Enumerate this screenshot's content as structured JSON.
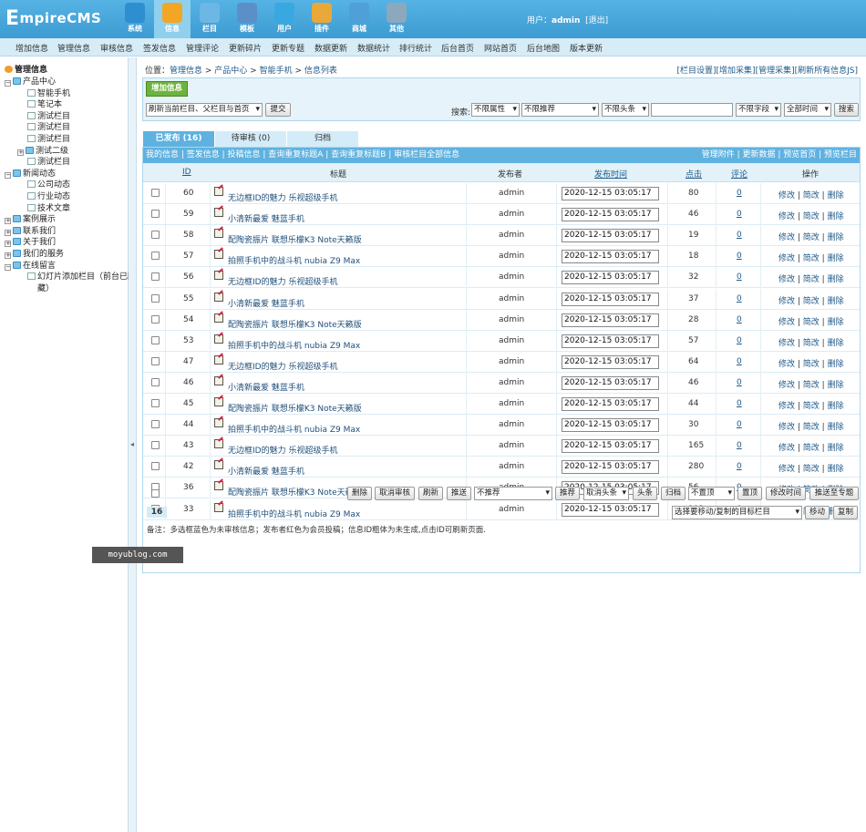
{
  "app": {
    "logo_big": "E",
    "logo_rest": "mpireCMS"
  },
  "nav": [
    {
      "label": "系统",
      "icon": "globe-icon",
      "color": "#2d8fd0"
    },
    {
      "label": "信息",
      "icon": "edit-icon",
      "color": "#f3a623"
    },
    {
      "label": "栏目",
      "icon": "folder-icon",
      "color": "#6cb7e6"
    },
    {
      "label": "模板",
      "icon": "template-icon",
      "color": "#5b8fc8"
    },
    {
      "label": "用户",
      "icon": "user-icon",
      "color": "#3aa8e0"
    },
    {
      "label": "插件",
      "icon": "tools-icon",
      "color": "#e8a83a"
    },
    {
      "label": "商城",
      "icon": "shop-icon",
      "color": "#4fa0d8"
    },
    {
      "label": "其他",
      "icon": "gear-icon",
      "color": "#8ca8bd"
    }
  ],
  "user": {
    "prefix": "用户：",
    "name": "admin",
    "logout": "[退出]"
  },
  "subnav": [
    "增加信息",
    "管理信息",
    "审核信息",
    "签发信息",
    "管理评论",
    "更新碎片",
    "更新专题",
    "数据更新",
    "数据统计",
    "排行统计",
    "后台首页",
    "网站首页",
    "后台地图",
    "版本更新"
  ],
  "tree": {
    "root": "管理信息",
    "items": [
      {
        "label": "产品中心",
        "level": 0,
        "type": "folder"
      },
      {
        "label": "智能手机",
        "level": 1,
        "type": "page"
      },
      {
        "label": "笔记本",
        "level": 1,
        "type": "page"
      },
      {
        "label": "测试栏目",
        "level": 1,
        "type": "page"
      },
      {
        "label": "测试栏目",
        "level": 1,
        "type": "page"
      },
      {
        "label": "测试栏目",
        "level": 1,
        "type": "page"
      },
      {
        "label": "测试二级",
        "level": 1,
        "type": "folder"
      },
      {
        "label": "测试栏目",
        "level": 1,
        "type": "page"
      },
      {
        "label": "新闻动态",
        "level": 0,
        "type": "folder"
      },
      {
        "label": "公司动态",
        "level": 1,
        "type": "page"
      },
      {
        "label": "行业动态",
        "level": 1,
        "type": "page"
      },
      {
        "label": "技术文章",
        "level": 1,
        "type": "page"
      },
      {
        "label": "案例展示",
        "level": 0,
        "type": "folder"
      },
      {
        "label": "联系我们",
        "level": 0,
        "type": "folder"
      },
      {
        "label": "关于我们",
        "level": 0,
        "type": "folder"
      },
      {
        "label": "我们的服务",
        "level": 0,
        "type": "folder"
      },
      {
        "label": "在线留言",
        "level": 0,
        "type": "folder"
      },
      {
        "label": "幻灯片添加栏目（前台已隐",
        "level": 1,
        "type": "page"
      },
      {
        "label": "藏）",
        "level": 1,
        "type": "cont"
      }
    ]
  },
  "location": {
    "prefix": "位置：",
    "crumbs": [
      "管理信息",
      "产品中心",
      "智能手机",
      "信息列表"
    ],
    "sep": " > "
  },
  "toplinks": [
    "[栏目设置]",
    "[增加采集]",
    "[管理采集]",
    "[刷新所有信息JS]"
  ],
  "toolbox": {
    "add": "增加信息",
    "refresh_select": "刷新当前栏目、父栏目与首页",
    "submit": "提交",
    "search_label": "搜索:",
    "sel_attr": "不限属性",
    "sel_rec": "不限推荐",
    "sel_head": "不限头条",
    "sel_field": "不限字段",
    "sel_time": "全部时间",
    "search_btn": "搜索"
  },
  "tabs": [
    "已发布 (16)",
    "待审核 (0)",
    "归档"
  ],
  "filter_left": "我的信息 | 签发信息 | 投稿信息 | 查询重复标题A | 查询重复标题B | 审核栏目全部信息",
  "filter_right": "管理附件 | 更新数据 | 预览首页 | 预览栏目",
  "headers": {
    "id": "ID",
    "title": "标题",
    "author": "发布者",
    "time": "发布时间",
    "hits": "点击",
    "comments": "评论",
    "ops": "操作"
  },
  "rows": [
    {
      "id": "60",
      "title": "无边框ID的魅力 乐视超级手机",
      "author": "admin",
      "time": "2020-12-15 03:05:17",
      "hits": "80",
      "comments": "0"
    },
    {
      "id": "59",
      "title": "小清新最爱 魅蓝手机",
      "author": "admin",
      "time": "2020-12-15 03:05:17",
      "hits": "46",
      "comments": "0"
    },
    {
      "id": "58",
      "title": "配陶瓷振片 联想乐檬K3 Note天籁版",
      "author": "admin",
      "time": "2020-12-15 03:05:17",
      "hits": "19",
      "comments": "0"
    },
    {
      "id": "57",
      "title": "拍照手机中的战斗机 nubia Z9 Max",
      "author": "admin",
      "time": "2020-12-15 03:05:17",
      "hits": "18",
      "comments": "0"
    },
    {
      "id": "56",
      "title": "无边框ID的魅力 乐视超级手机",
      "author": "admin",
      "time": "2020-12-15 03:05:17",
      "hits": "32",
      "comments": "0"
    },
    {
      "id": "55",
      "title": "小清新最爱 魅蓝手机",
      "author": "admin",
      "time": "2020-12-15 03:05:17",
      "hits": "37",
      "comments": "0"
    },
    {
      "id": "54",
      "title": "配陶瓷振片 联想乐檬K3 Note天籁版",
      "author": "admin",
      "time": "2020-12-15 03:05:17",
      "hits": "28",
      "comments": "0"
    },
    {
      "id": "53",
      "title": "拍照手机中的战斗机 nubia Z9 Max",
      "author": "admin",
      "time": "2020-12-15 03:05:17",
      "hits": "57",
      "comments": "0"
    },
    {
      "id": "47",
      "title": "无边框ID的魅力 乐视超级手机",
      "author": "admin",
      "time": "2020-12-15 03:05:17",
      "hits": "64",
      "comments": "0"
    },
    {
      "id": "46",
      "title": "小清新最爱 魅蓝手机",
      "author": "admin",
      "time": "2020-12-15 03:05:17",
      "hits": "46",
      "comments": "0"
    },
    {
      "id": "45",
      "title": "配陶瓷振片 联想乐檬K3 Note天籁版",
      "author": "admin",
      "time": "2020-12-15 03:05:17",
      "hits": "44",
      "comments": "0"
    },
    {
      "id": "44",
      "title": "拍照手机中的战斗机 nubia Z9 Max",
      "author": "admin",
      "time": "2020-12-15 03:05:17",
      "hits": "30",
      "comments": "0"
    },
    {
      "id": "43",
      "title": "无边框ID的魅力 乐视超级手机",
      "author": "admin",
      "time": "2020-12-15 03:05:17",
      "hits": "165",
      "comments": "0"
    },
    {
      "id": "42",
      "title": "小清新最爱 魅蓝手机",
      "author": "admin",
      "time": "2020-12-15 03:05:17",
      "hits": "280",
      "comments": "0"
    },
    {
      "id": "36",
      "title": "配陶瓷振片 联想乐檬K3 Note天籁版",
      "author": "admin",
      "time": "2020-12-15 03:05:17",
      "hits": "56",
      "comments": "0"
    },
    {
      "id": "33",
      "title": "拍照手机中的战斗机 nubia Z9 Max",
      "author": "admin",
      "time": "2020-12-15 03:05:17",
      "hits": "102",
      "comments": "0"
    }
  ],
  "row_ops": {
    "edit": "修改",
    "quick": "简改",
    "del": "删除",
    "sep": " | "
  },
  "bottom": {
    "b1": "删除",
    "b2": "取消审核",
    "b3": "刷新",
    "b4": "推送",
    "sel_rec": "不推荐",
    "b5": "推荐",
    "sel_head": "取消头条",
    "b6": "头条",
    "b7": "归档",
    "sel_top": "不置顶",
    "b8": "置顶",
    "b9": "修改时间",
    "b10": "推送至专题",
    "sel_move": "选择要移动/复制的目标栏目",
    "b11": "移动",
    "b12": "复制"
  },
  "page_num": "16",
  "note": "备注：多选框蓝色为未审核信息；发布者红色为会员投稿；信息ID粗体为未生成,点击ID可刷新页面.",
  "watermark": "moyublog.com"
}
